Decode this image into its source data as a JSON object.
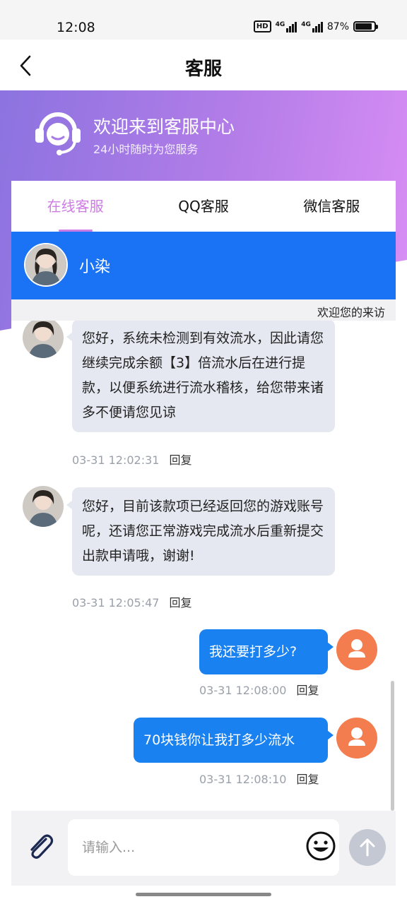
{
  "status": {
    "time": "12:08",
    "hd": "HD",
    "net1": "4G",
    "net2": "4G",
    "battery_text": "87%",
    "battery_level": 0.87
  },
  "nav": {
    "title": "客服"
  },
  "hero": {
    "title": "欢迎来到客服中心",
    "subtitle": "24小时随时为您服务"
  },
  "tabs": [
    {
      "label": "在线客服",
      "active": true
    },
    {
      "label": "QQ客服",
      "active": false
    },
    {
      "label": "微信客服",
      "active": false
    }
  ],
  "agent": {
    "name": "小染"
  },
  "marquee": {
    "text": "欢迎您的来访"
  },
  "messages": [
    {
      "from": "agent",
      "text": "您好，系统未检测到有效流水，因此请您继续完成余额【3】倍流水后在进行提款，以便系统进行流水稽核，给您带来诸多不便请您见谅",
      "time": "03-31 12:02:31",
      "reply": "回复"
    },
    {
      "from": "agent",
      "text": "您好，目前该款项已经返回您的游戏账号呢，还请您正常游戏完成流水后重新提交出款申请哦，谢谢!",
      "time": "03-31 12:05:47",
      "reply": "回复"
    },
    {
      "from": "user",
      "text": "我还要打多少?",
      "time": "03-31 12:08:00",
      "reply": "回复"
    },
    {
      "from": "user",
      "text": "70块钱你让我打多少流水",
      "time": "03-31 12:08:10",
      "reply": "回复"
    }
  ],
  "input": {
    "placeholder": "请输入..."
  },
  "colors": {
    "accent_tab": "#cf7be6",
    "agent_bar": "#1a73f5",
    "user_bubble": "#1a82f0",
    "user_avatar": "#f37d4f"
  },
  "icons": {
    "back": "chevron-left-icon",
    "headset": "headset-icon",
    "attach": "paperclip-icon",
    "emoji": "smiley-icon",
    "send": "arrow-up-icon"
  }
}
